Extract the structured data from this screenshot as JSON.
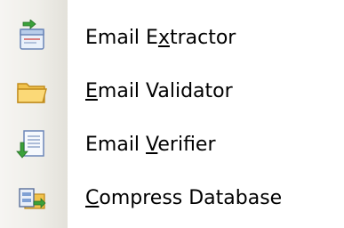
{
  "menu": {
    "items": [
      {
        "label": "Email Extractor",
        "label_parts": [
          "Email E",
          "x",
          "tractor"
        ],
        "icon": "email-extractor-icon"
      },
      {
        "label": "Email Validator",
        "label_parts": [
          "",
          "E",
          "mail Validator"
        ],
        "icon": "folder-icon"
      },
      {
        "label": "Email Verifier",
        "label_parts": [
          "Email ",
          "V",
          "erifier"
        ],
        "icon": "document-verify-icon"
      },
      {
        "label": "Compress Database",
        "label_parts": [
          "",
          "C",
          "ompress Database"
        ],
        "icon": "compress-database-icon"
      }
    ]
  }
}
